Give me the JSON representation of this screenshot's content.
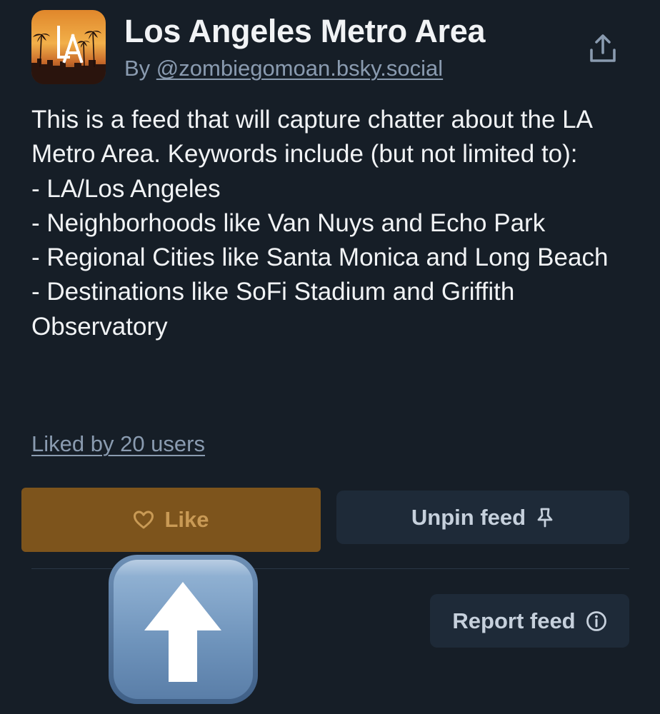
{
  "feed": {
    "title": "Los Angeles Metro Area",
    "by_prefix": "By ",
    "author": "@zombiegomoan.bsky.social",
    "description": "This is a feed that will capture chatter about the LA Metro Area. Keywords include (but not limited to):\n- LA/Los Angeles\n- Neighborhoods like Van Nuys and Echo Park\n- Regional Cities like Santa Monica and Long Beach\n- Destinations like SoFi Stadium and Griffith Observatory",
    "liked_by": "Liked by 20 users",
    "avatar_logo_text": "LA"
  },
  "actions": {
    "like_label": "Like",
    "unpin_label": "Unpin feed",
    "report_label": "Report feed"
  },
  "icons": {
    "share": "share-icon",
    "heart": "heart-outline-icon",
    "pin": "pin-icon",
    "info": "info-circle-icon",
    "overlay": "up-arrow-emoji"
  },
  "colors": {
    "background": "#161e27",
    "text_primary": "#f1f3f5",
    "text_secondary": "#8a9bb0",
    "like_button_bg": "#7d541c",
    "like_button_text": "#c99a55",
    "secondary_button_bg": "#1e2a38"
  }
}
